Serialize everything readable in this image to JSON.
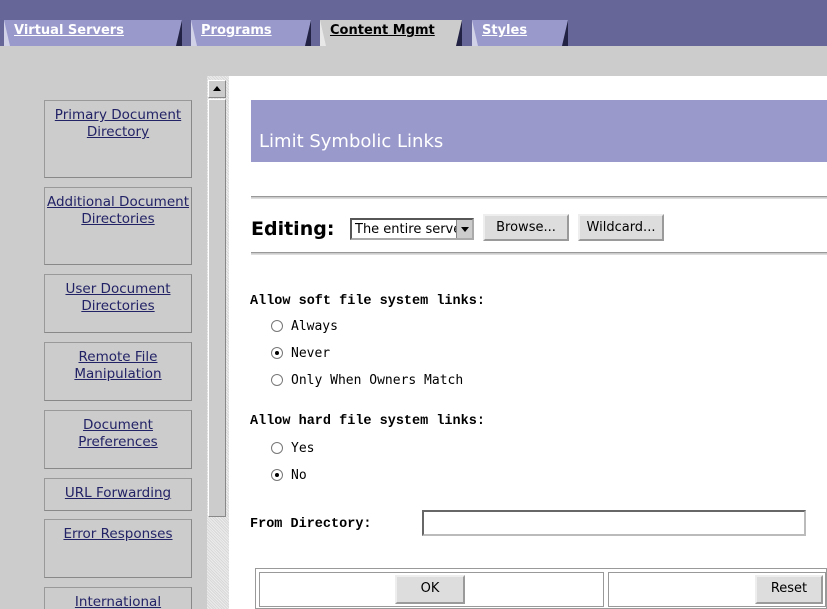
{
  "tabs": [
    {
      "label": "Virtual Servers",
      "active": false
    },
    {
      "label": "Programs",
      "active": false
    },
    {
      "label": "Content Mgmt",
      "active": true
    },
    {
      "label": "Styles",
      "active": false
    }
  ],
  "sidebar": {
    "items": [
      {
        "label": "Primary Document Directory"
      },
      {
        "label": "Additional Document Directories"
      },
      {
        "label": "User Document Directories"
      },
      {
        "label": "Remote File Manipulation"
      },
      {
        "label": "Document Preferences"
      },
      {
        "label": "URL Forwarding"
      },
      {
        "label": "Error Responses"
      },
      {
        "label": "International"
      }
    ]
  },
  "page": {
    "title": "Limit Symbolic Links",
    "editing_label": "Editing:",
    "editing_value": "The entire server",
    "browse_label": "Browse...",
    "wildcard_label": "Wildcard..."
  },
  "soft_links": {
    "heading": "Allow soft file system links:",
    "options": [
      {
        "label": "Always",
        "selected": false
      },
      {
        "label": "Never",
        "selected": true
      },
      {
        "label": "Only When Owners Match",
        "selected": false
      }
    ]
  },
  "hard_links": {
    "heading": "Allow hard file system links:",
    "options": [
      {
        "label": "Yes",
        "selected": false
      },
      {
        "label": "No",
        "selected": true
      }
    ]
  },
  "from_directory": {
    "label": "From Directory:",
    "value": ""
  },
  "footer": {
    "ok_label": "OK",
    "reset_label": "Reset"
  },
  "colors": {
    "tab_bar": "#666699",
    "header_band": "#9999cc",
    "panel": "#cccccc"
  }
}
